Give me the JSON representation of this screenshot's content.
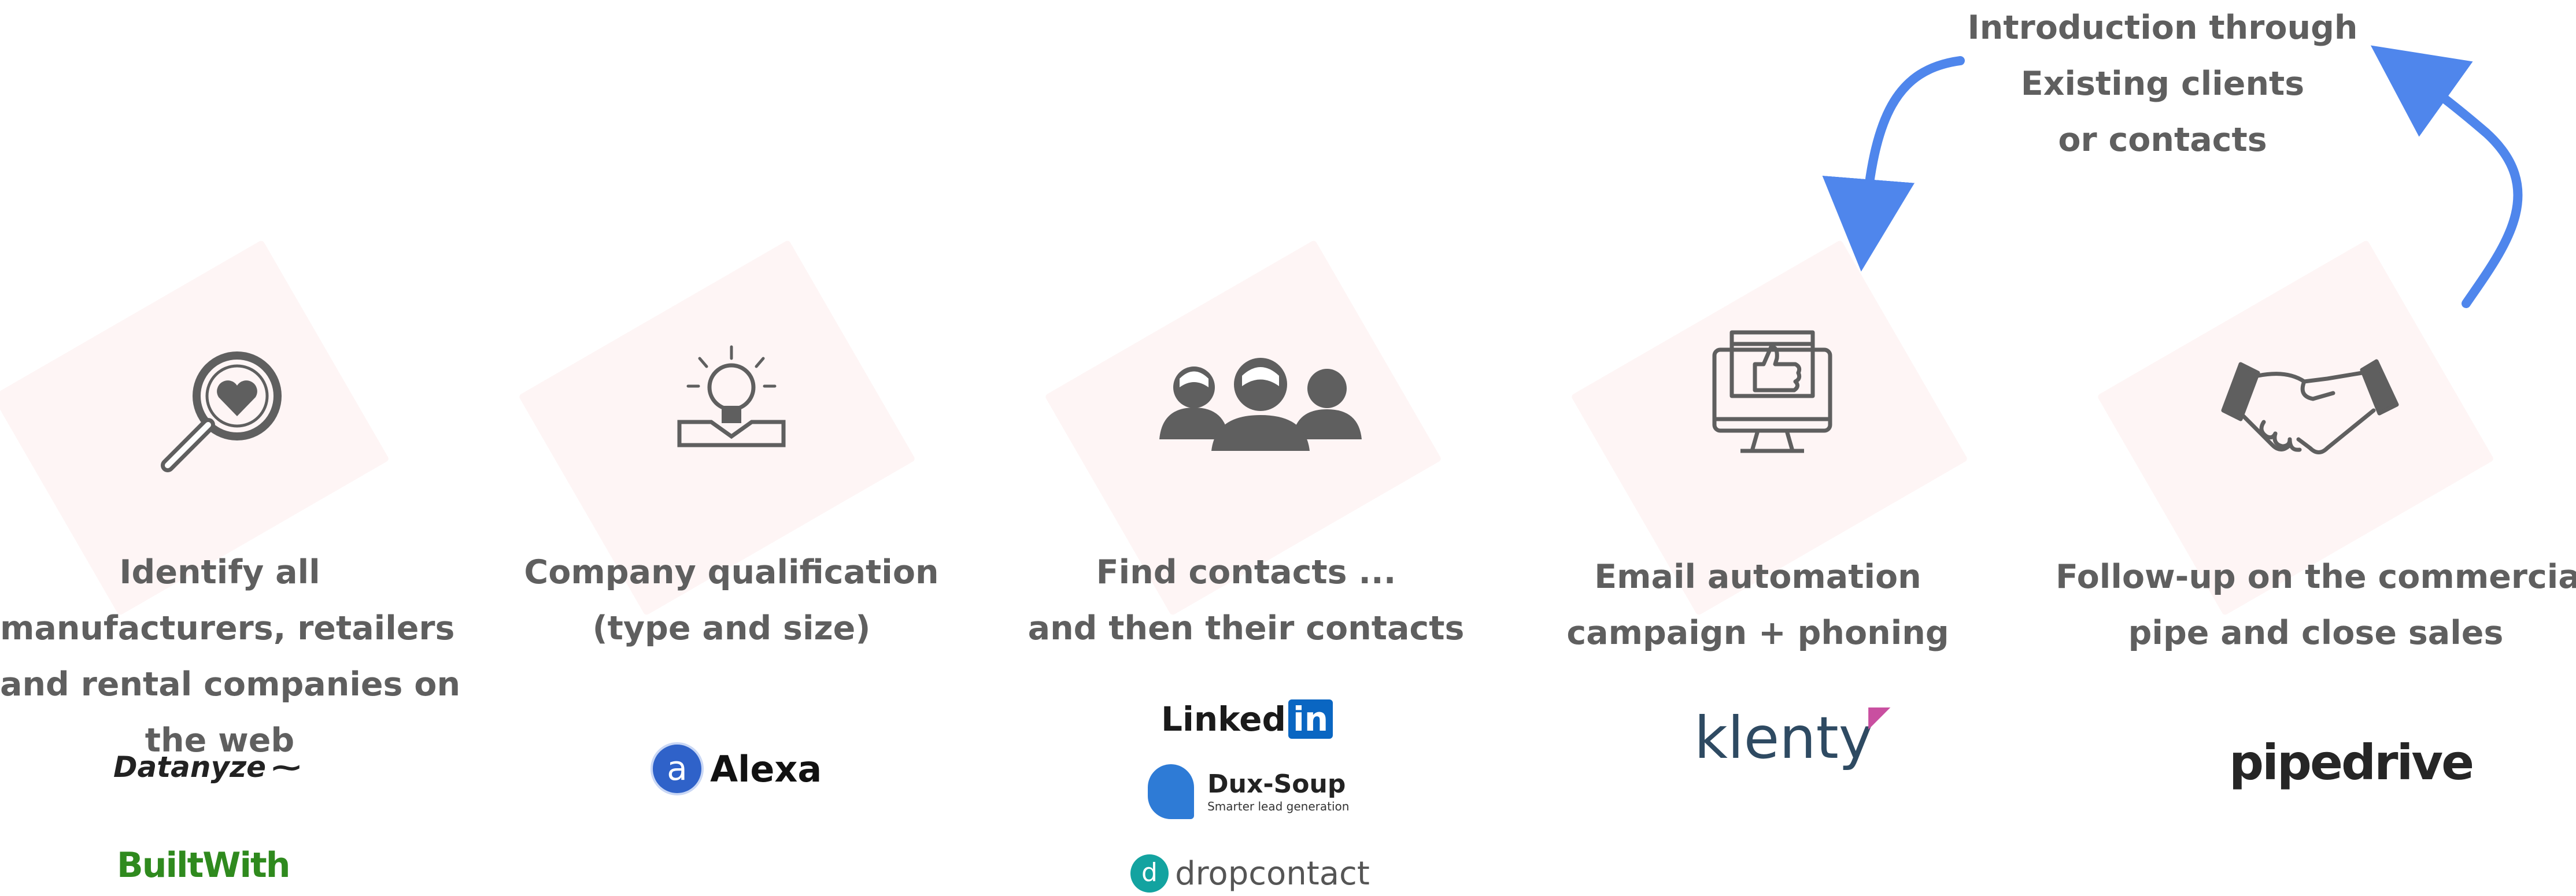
{
  "intro": {
    "lines": [
      "Introduction through",
      "Existing clients",
      "or contacts"
    ]
  },
  "steps": [
    {
      "caption": [
        "Identify all",
        "manufacturers, retailers",
        "and rental companies on",
        "the web"
      ],
      "tools": [
        "Datanyze",
        "BuiltWith"
      ],
      "icon": "magnifier-heart-icon"
    },
    {
      "caption": [
        "Company qualification",
        "(type and size)"
      ],
      "tools": [
        "Alexa"
      ],
      "icon": "lightbulb-icon"
    },
    {
      "caption": [
        "Find contacts ...",
        "and then their contacts"
      ],
      "tools": [
        "Linked",
        "in",
        "Dux-Soup",
        "Smarter lead generation",
        "dropcontact"
      ],
      "icon": "people-group-icon"
    },
    {
      "caption": [
        "Email automation",
        "campaign + phoning"
      ],
      "tools": [
        "klenty"
      ],
      "icon": "monitor-thumbs-up-icon"
    },
    {
      "caption": [
        "Follow-up on the commercial",
        "pipe and close sales"
      ],
      "tools": [
        "pipedrive"
      ],
      "icon": "handshake-icon"
    }
  ],
  "colors": {
    "text": "#5f5f5f",
    "arrow": "#4f86ec",
    "icon": "#5f5f5f",
    "bg_shape": "#fdecec"
  }
}
